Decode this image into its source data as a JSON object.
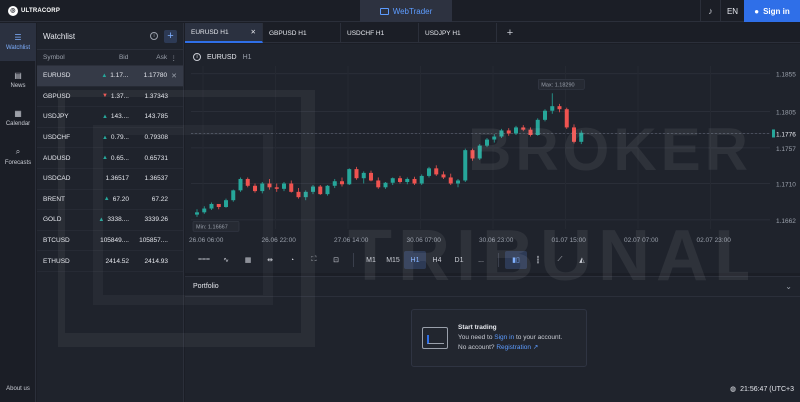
{
  "app": {
    "logo_text": "ULTRACORP",
    "webtrader_label": "WebTrader",
    "language": "EN",
    "signin_label": "Sign in"
  },
  "leftnav": {
    "items": [
      {
        "label": "Watchlist",
        "icon": "list-icon"
      },
      {
        "label": "News",
        "icon": "news-icon"
      },
      {
        "label": "Calendar",
        "icon": "calendar-icon"
      },
      {
        "label": "Forecasts",
        "icon": "forecast-icon"
      }
    ],
    "about": "About us"
  },
  "watchlist": {
    "title": "Watchlist",
    "columns": {
      "symbol": "Symbol",
      "bid": "Bid",
      "ask": "Ask"
    },
    "rows": [
      {
        "symbol": "EURUSD",
        "bid": "1.17...",
        "ask": "1.17780",
        "dir": "up"
      },
      {
        "symbol": "GBPUSD",
        "bid": "1.37...",
        "ask": "1.37343",
        "dir": "down"
      },
      {
        "symbol": "USDJPY",
        "bid": "143....",
        "ask": "143.785",
        "dir": "up"
      },
      {
        "symbol": "USDCHF",
        "bid": "0.79...",
        "ask": "0.79308",
        "dir": "up"
      },
      {
        "symbol": "AUDUSD",
        "bid": "0.65...",
        "ask": "0.65731",
        "dir": "up"
      },
      {
        "symbol": "USDCAD",
        "bid": "1.36517",
        "ask": "1.36537",
        "dir": ""
      },
      {
        "symbol": "BRENT",
        "bid": "67.20",
        "ask": "67.22",
        "dir": "up"
      },
      {
        "symbol": "GOLD",
        "bid": "3338....",
        "ask": "3339.26",
        "dir": "up"
      },
      {
        "symbol": "BTCUSD",
        "bid": "105849....",
        "ask": "105857....",
        "dir": ""
      },
      {
        "symbol": "ETHUSD",
        "bid": "2414.52",
        "ask": "2414.93",
        "dir": ""
      }
    ]
  },
  "tabs": [
    {
      "label": "EURUSD H1"
    },
    {
      "label": "GBPUSD H1"
    },
    {
      "label": "USDCHF H1"
    },
    {
      "label": "USDJPY H1"
    }
  ],
  "chart": {
    "symbol": "EURUSD",
    "timeframe": "H1",
    "max_label": "Max: 1.18290",
    "min_label": "Min: 1.16667",
    "price_ticks": [
      "1.1855",
      "1.1805",
      "1.1776",
      "1.1757",
      "1.1710",
      "1.1662"
    ],
    "time_ticks": [
      "26.06 06:00",
      "26.06 22:00",
      "27.06 14:00",
      "30.06 07:00",
      "30.06 23:00",
      "01.07 15:00",
      "02.07 07:00",
      "02.07 23:00"
    ],
    "candles": [
      [
        1.1669,
        1.1676,
        1.1666,
        1.1672
      ],
      [
        1.1672,
        1.168,
        1.167,
        1.1677
      ],
      [
        1.1677,
        1.1685,
        1.1675,
        1.1683
      ],
      [
        1.1683,
        1.1683,
        1.1676,
        1.1679
      ],
      [
        1.1679,
        1.169,
        1.1678,
        1.1688
      ],
      [
        1.1688,
        1.1702,
        1.1686,
        1.1701
      ],
      [
        1.1701,
        1.1718,
        1.1699,
        1.1716
      ],
      [
        1.1716,
        1.1718,
        1.1705,
        1.1707
      ],
      [
        1.1707,
        1.171,
        1.1698,
        1.17
      ],
      [
        1.17,
        1.1712,
        1.1697,
        1.171
      ],
      [
        1.171,
        1.1716,
        1.1702,
        1.1705
      ],
      [
        1.1705,
        1.171,
        1.1699,
        1.1703
      ],
      [
        1.1703,
        1.1712,
        1.17,
        1.171
      ],
      [
        1.171,
        1.1714,
        1.1698,
        1.1699
      ],
      [
        1.1699,
        1.1704,
        1.169,
        1.1692
      ],
      [
        1.1692,
        1.1701,
        1.1688,
        1.1699
      ],
      [
        1.1699,
        1.1708,
        1.1696,
        1.1706
      ],
      [
        1.1706,
        1.1708,
        1.1695,
        1.1696
      ],
      [
        1.1696,
        1.1708,
        1.1694,
        1.1707
      ],
      [
        1.1707,
        1.1716,
        1.1704,
        1.1713
      ],
      [
        1.1713,
        1.1718,
        1.1706,
        1.1709
      ],
      [
        1.1709,
        1.173,
        1.1708,
        1.1729
      ],
      [
        1.1729,
        1.1732,
        1.1715,
        1.1717
      ],
      [
        1.1717,
        1.1726,
        1.171,
        1.1724
      ],
      [
        1.1724,
        1.1727,
        1.1713,
        1.1714
      ],
      [
        1.1714,
        1.1718,
        1.1703,
        1.1705
      ],
      [
        1.1705,
        1.1712,
        1.1703,
        1.1711
      ],
      [
        1.1711,
        1.1718,
        1.1708,
        1.1717
      ],
      [
        1.1717,
        1.172,
        1.171,
        1.1712
      ],
      [
        1.1712,
        1.1718,
        1.1709,
        1.1716
      ],
      [
        1.1716,
        1.1719,
        1.1708,
        1.171
      ],
      [
        1.171,
        1.1722,
        1.1708,
        1.172
      ],
      [
        1.172,
        1.1732,
        1.1718,
        1.173
      ],
      [
        1.173,
        1.1734,
        1.172,
        1.1722
      ],
      [
        1.1722,
        1.1726,
        1.1716,
        1.1718
      ],
      [
        1.1718,
        1.1723,
        1.1708,
        1.171
      ],
      [
        1.171,
        1.1716,
        1.1705,
        1.1714
      ],
      [
        1.1714,
        1.1756,
        1.1712,
        1.1754
      ],
      [
        1.1754,
        1.1756,
        1.174,
        1.1743
      ],
      [
        1.1743,
        1.1762,
        1.1741,
        1.176
      ],
      [
        1.176,
        1.177,
        1.1758,
        1.1768
      ],
      [
        1.1768,
        1.1775,
        1.1764,
        1.1772
      ],
      [
        1.1772,
        1.1782,
        1.177,
        1.178
      ],
      [
        1.178,
        1.1783,
        1.1773,
        1.1776
      ],
      [
        1.1776,
        1.1786,
        1.1774,
        1.1784
      ],
      [
        1.1784,
        1.1787,
        1.1779,
        1.1781
      ],
      [
        1.1781,
        1.1784,
        1.1772,
        1.1774
      ],
      [
        1.1774,
        1.1796,
        1.1773,
        1.1794
      ],
      [
        1.1794,
        1.1808,
        1.1792,
        1.1806
      ],
      [
        1.1806,
        1.1829,
        1.1802,
        1.1812
      ],
      [
        1.1812,
        1.1815,
        1.1804,
        1.1808
      ],
      [
        1.1808,
        1.181,
        1.1782,
        1.1784
      ],
      [
        1.1784,
        1.1788,
        1.1763,
        1.1765
      ],
      [
        1.1765,
        1.178,
        1.1762,
        1.1777
      ]
    ]
  },
  "chart_data": {
    "type": "candlestick",
    "title": "EURUSD H1",
    "x_ticks": [
      "26.06 06:00",
      "26.06 22:00",
      "27.06 14:00",
      "30.06 07:00",
      "30.06 23:00",
      "01.07 15:00",
      "02.07 07:00",
      "02.07 23:00"
    ],
    "y_ticks": [
      1.1855,
      1.1805,
      1.1776,
      1.1757,
      1.171,
      1.1662
    ],
    "ylim": [
      1.165,
      1.1865
    ],
    "max": 1.1829,
    "min": 1.16667,
    "current": 1.1776
  },
  "toolbar": {
    "timeframes": [
      "M1",
      "M15",
      "H1",
      "H4",
      "D1"
    ],
    "more": "...",
    "active_tf": "H1"
  },
  "portfolio": {
    "title": "Portfolio",
    "card_title": "Start trading",
    "line1_pre": "You need to",
    "line1_link": "Sign in",
    "line1_post": "to your account.",
    "line2_pre": "No account?",
    "line2_link": "Registration"
  },
  "status": {
    "time": "21:56:47 (UTC+3"
  },
  "watermark": {
    "line1": "BROKER",
    "line2": "TRIBUNAL"
  },
  "colors": {
    "up": "#26a69a",
    "down": "#ef5350",
    "accent": "#2f6fe8"
  }
}
